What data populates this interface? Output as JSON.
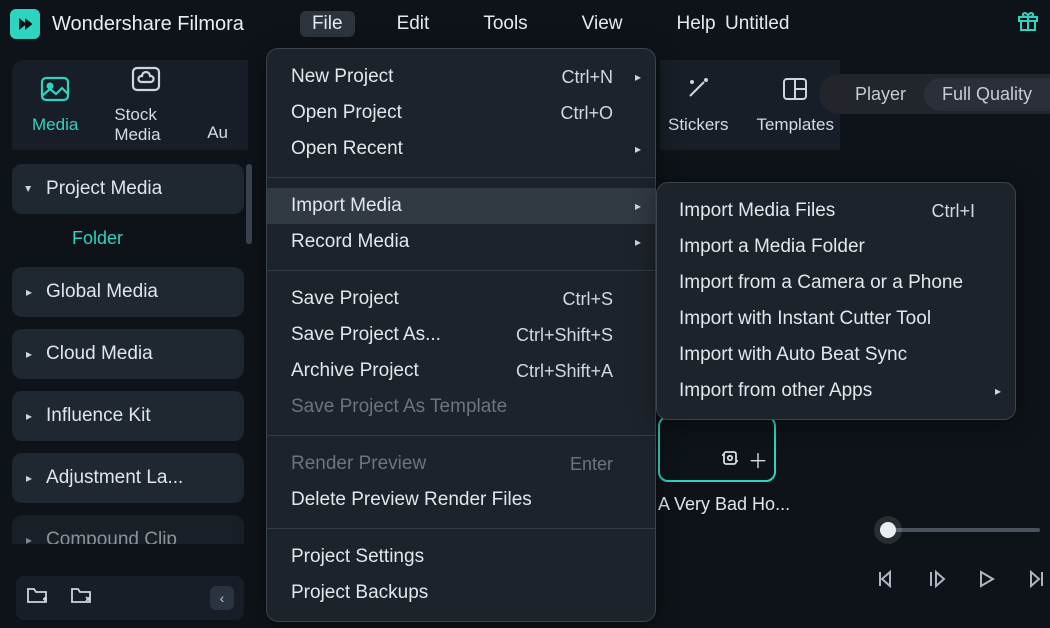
{
  "app": {
    "title": "Wondershare Filmora",
    "document": "Untitled"
  },
  "menubar": [
    "File",
    "Edit",
    "Tools",
    "View",
    "Help"
  ],
  "left_tabs": [
    {
      "label": "Media",
      "active": true
    },
    {
      "label": "Stock Media",
      "active": false
    },
    {
      "label": "Au",
      "active": false
    }
  ],
  "sidebar": {
    "items": [
      {
        "label": "Project Media",
        "expanded": true,
        "children": [
          "Folder"
        ]
      },
      {
        "label": "Global Media"
      },
      {
        "label": "Cloud Media"
      },
      {
        "label": "Influence Kit"
      },
      {
        "label": "Adjustment La..."
      },
      {
        "label": "Compound Clip",
        "fade": true
      }
    ]
  },
  "right_tabs": [
    {
      "label": "Stickers"
    },
    {
      "label": "Templates"
    }
  ],
  "player_tabs": [
    "Player",
    "Full Quality"
  ],
  "thumbnail": {
    "label": "A Very Bad Ho..."
  },
  "file_menu": {
    "groups": [
      [
        {
          "label": "New Project",
          "shortcut": "Ctrl+N",
          "sub": true
        },
        {
          "label": "Open Project",
          "shortcut": "Ctrl+O"
        },
        {
          "label": "Open Recent",
          "sub": true
        }
      ],
      [
        {
          "label": "Import Media",
          "sub": true,
          "highlight": true
        },
        {
          "label": "Record Media",
          "sub": true
        }
      ],
      [
        {
          "label": "Save Project",
          "shortcut": "Ctrl+S"
        },
        {
          "label": "Save Project As...",
          "shortcut": "Ctrl+Shift+S"
        },
        {
          "label": "Archive Project",
          "shortcut": "Ctrl+Shift+A"
        },
        {
          "label": "Save Project As Template",
          "disabled": true
        }
      ],
      [
        {
          "label": "Render Preview",
          "shortcut": "Enter",
          "disabled": true
        },
        {
          "label": "Delete Preview Render Files"
        }
      ],
      [
        {
          "label": "Project Settings"
        },
        {
          "label": "Project Backups"
        }
      ]
    ]
  },
  "import_submenu": [
    {
      "label": "Import Media Files",
      "shortcut": "Ctrl+I"
    },
    {
      "label": "Import a Media Folder"
    },
    {
      "label": "Import from a Camera or a Phone"
    },
    {
      "label": "Import with Instant Cutter Tool"
    },
    {
      "label": "Import with Auto Beat Sync"
    },
    {
      "label": "Import from other Apps",
      "sub": true
    }
  ]
}
